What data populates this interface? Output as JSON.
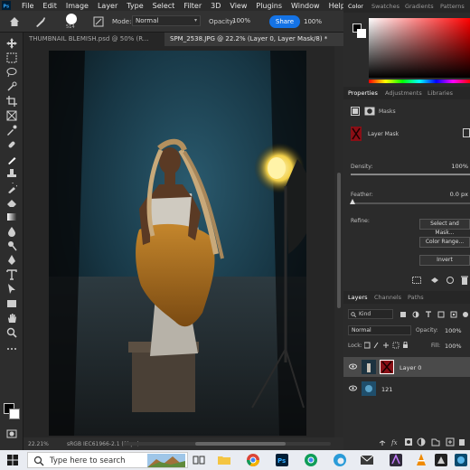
{
  "menubar": {
    "items": [
      "File",
      "Edit",
      "Image",
      "Layer",
      "Type",
      "Select",
      "Filter",
      "3D",
      "View",
      "Plugins",
      "Window",
      "Help"
    ],
    "window_controls": [
      "—",
      "□"
    ]
  },
  "options": {
    "brush_size": "514",
    "mode_label": "Mode:",
    "mode_value": "Normal",
    "opacity_label": "Opacity:",
    "opacity_value": "100%",
    "share_label": "Share",
    "flow_value": "100%"
  },
  "tabs": [
    {
      "label": "THUMBNAIL BLEMISH.psd @ 50% (R...",
      "active": false
    },
    {
      "label": "SPM_2538.JPG @ 22.2% (Layer 0, Layer Mask/8) *",
      "active": true
    }
  ],
  "status": {
    "zoom": "22.21%",
    "profile": "sRGB IEC61966-2.1 (8bpc)"
  },
  "color_panel": {
    "tabs": [
      "Color",
      "Swatches",
      "Gradients",
      "Patterns"
    ]
  },
  "properties_panel": {
    "tabs": [
      "Properties",
      "Adjustments",
      "Libraries"
    ],
    "masks_label": "Masks",
    "layer_mask_label": "Layer Mask",
    "density_label": "Density:",
    "density_value": "100%",
    "feather_label": "Feather:",
    "feather_value": "0.0 px",
    "refine_label": "Refine:",
    "buttons": [
      "Select and Mask...",
      "Color Range...",
      "Invert"
    ]
  },
  "layers_panel": {
    "tabs": [
      "Layers",
      "Channels",
      "Paths"
    ],
    "filter_label": "Kind",
    "blend_mode": "Normal",
    "opacity_label": "Opacity:",
    "opacity_value": "100%",
    "lock_label": "Lock:",
    "fill_label": "Fill:",
    "fill_value": "100%",
    "layers": [
      {
        "name": "Layer 0",
        "selected": true
      },
      {
        "name": "121",
        "selected": false
      }
    ]
  },
  "taskbar": {
    "search_placeholder": "Type here to search"
  },
  "colors": {
    "accent": "#1473e6",
    "mask_red": "#b0101a",
    "panel": "#2b2b2b"
  }
}
